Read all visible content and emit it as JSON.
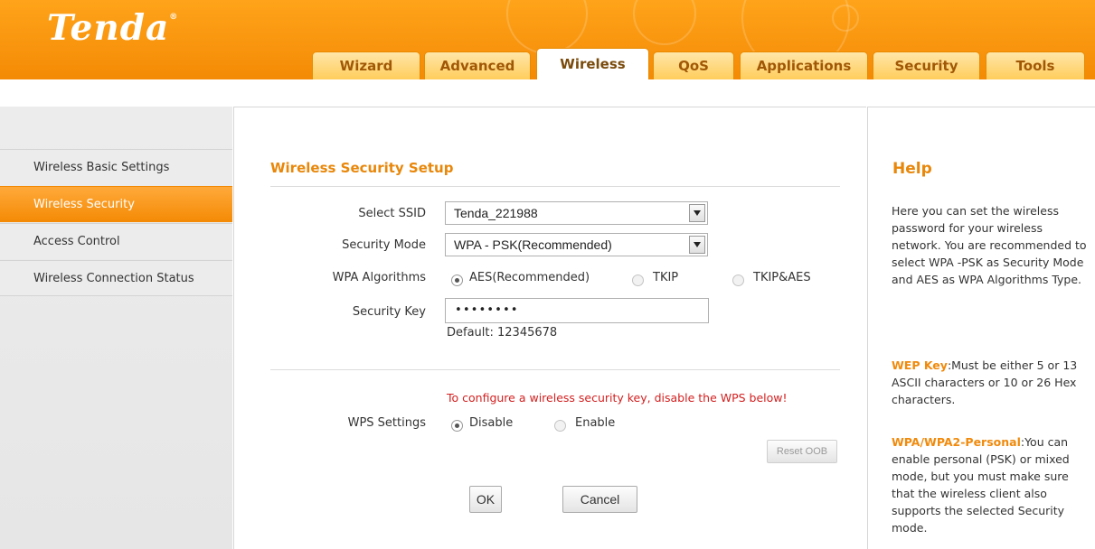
{
  "header": {
    "logo": "Tenda",
    "logo_mark": "®",
    "tabs": [
      {
        "label": "Wizard",
        "active": false
      },
      {
        "label": "Advanced",
        "active": false
      },
      {
        "label": "Wireless",
        "active": true
      },
      {
        "label": "QoS",
        "active": false
      },
      {
        "label": "Applications",
        "active": false
      },
      {
        "label": "Security",
        "active": false
      },
      {
        "label": "Tools",
        "active": false
      }
    ]
  },
  "sidebar": {
    "items": [
      {
        "label": "Wireless Basic Settings",
        "active": false
      },
      {
        "label": "Wireless Security",
        "active": true
      },
      {
        "label": "Access Control",
        "active": false
      },
      {
        "label": "Wireless Connection Status",
        "active": false
      }
    ]
  },
  "main": {
    "title": "Wireless Security Setup",
    "ssid": {
      "label": "Select SSID",
      "value": "Tenda_221988"
    },
    "security_mode": {
      "label": "Security Mode",
      "value": "WPA - PSK(Recommended)"
    },
    "wpa_algorithms": {
      "label": "WPA Algorithms",
      "options": [
        "AES(Recommended)",
        "TKIP",
        "TKIP&AES"
      ],
      "selected": "AES(Recommended)"
    },
    "security_key": {
      "label": "Security Key",
      "value": "••••••••",
      "default_note": "Default: 12345678"
    },
    "wps_warning": "To configure a wireless security key, disable the WPS below!",
    "wps": {
      "label": "WPS Settings",
      "options": [
        "Disable",
        "Enable"
      ],
      "selected": "Disable"
    },
    "reset_oob_label": "Reset OOB",
    "ok_label": "OK",
    "cancel_label": "Cancel"
  },
  "help": {
    "title": "Help",
    "intro": "Here you can set the wireless password for your wireless network. You are recommended to select WPA -PSK as Security Mode and AES as WPA Algorithms Type.",
    "wep_key_term": "WEP Key",
    "wep_key_text": ":Must be either 5 or 13 ASCII characters or 10 or 26 Hex characters.",
    "wpa_term": "WPA/WPA2-Personal",
    "wpa_text": ":You can enable personal (PSK) or mixed mode, but you must make sure that the wireless client also supports the selected Security mode."
  },
  "colors": {
    "brand_orange": "#f48a05",
    "title_orange": "#e8870a",
    "warning_red": "#d42020"
  },
  "icons": {
    "select_arrow": "chevron-down-icon",
    "radio": "radio-icon"
  }
}
